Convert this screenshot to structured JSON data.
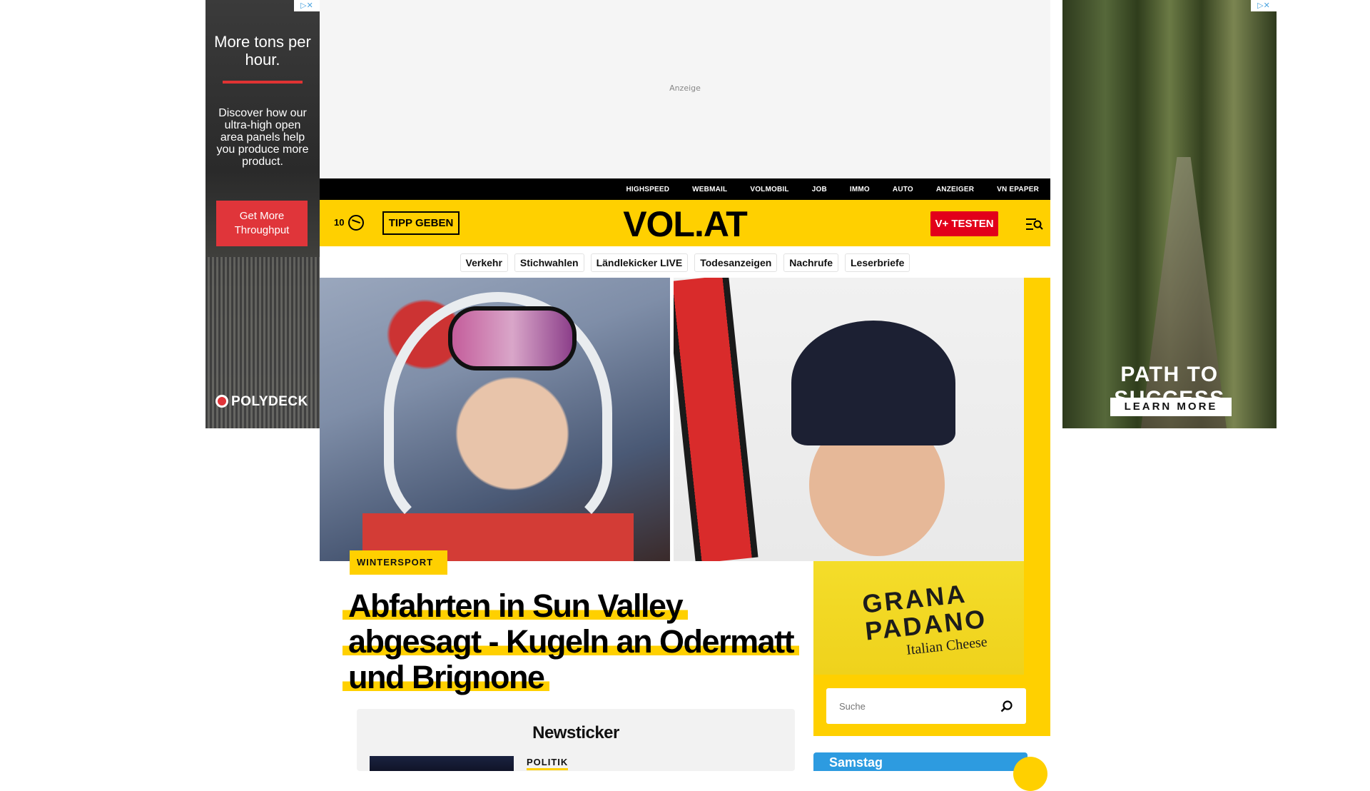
{
  "ads": {
    "left": {
      "badge": "▷✕",
      "headline": "More tons per hour.",
      "body": "Discover how our ultra-high open area panels help you produce more product.",
      "cta": "Get More Throughput",
      "brand": "POLYDECK"
    },
    "right": {
      "badge": "▷✕",
      "headline": "PATH TO SUCCESS",
      "cta": "LEARN MORE"
    },
    "top": {
      "label": "Anzeige"
    }
  },
  "topbar": {
    "links": [
      "HIGHSPEED",
      "WEBMAIL",
      "VOLMOBIL",
      "JOB",
      "IMMO",
      "AUTO",
      "ANZEIGER",
      "VN EPAPER"
    ]
  },
  "header": {
    "count": "10",
    "tipp_label": "TIPP GEBEN",
    "logo": "VOL.AT",
    "vplus_label": "V+ TESTEN",
    "colors": {
      "yellow": "#ffd000",
      "red": "#e2001a"
    }
  },
  "nav": {
    "pills": [
      "Verkehr",
      "Stichwahlen",
      "Ländlekicker LIVE",
      "Todesanzeigen",
      "Nachrufe",
      "Leserbriefe"
    ]
  },
  "article": {
    "kicker": "WINTERSPORT",
    "headline": "Abfahrten in Sun Valley abgesagt - Kugeln an Odermatt und Brignone"
  },
  "image_right": {
    "bib_text": "GRANA PADANO",
    "bib_sub": "Italian Cheese"
  },
  "search": {
    "placeholder": "Suche"
  },
  "ticker": {
    "title": "Newsticker",
    "category": "POLITIK"
  },
  "weather": {
    "day": "Samstag"
  }
}
